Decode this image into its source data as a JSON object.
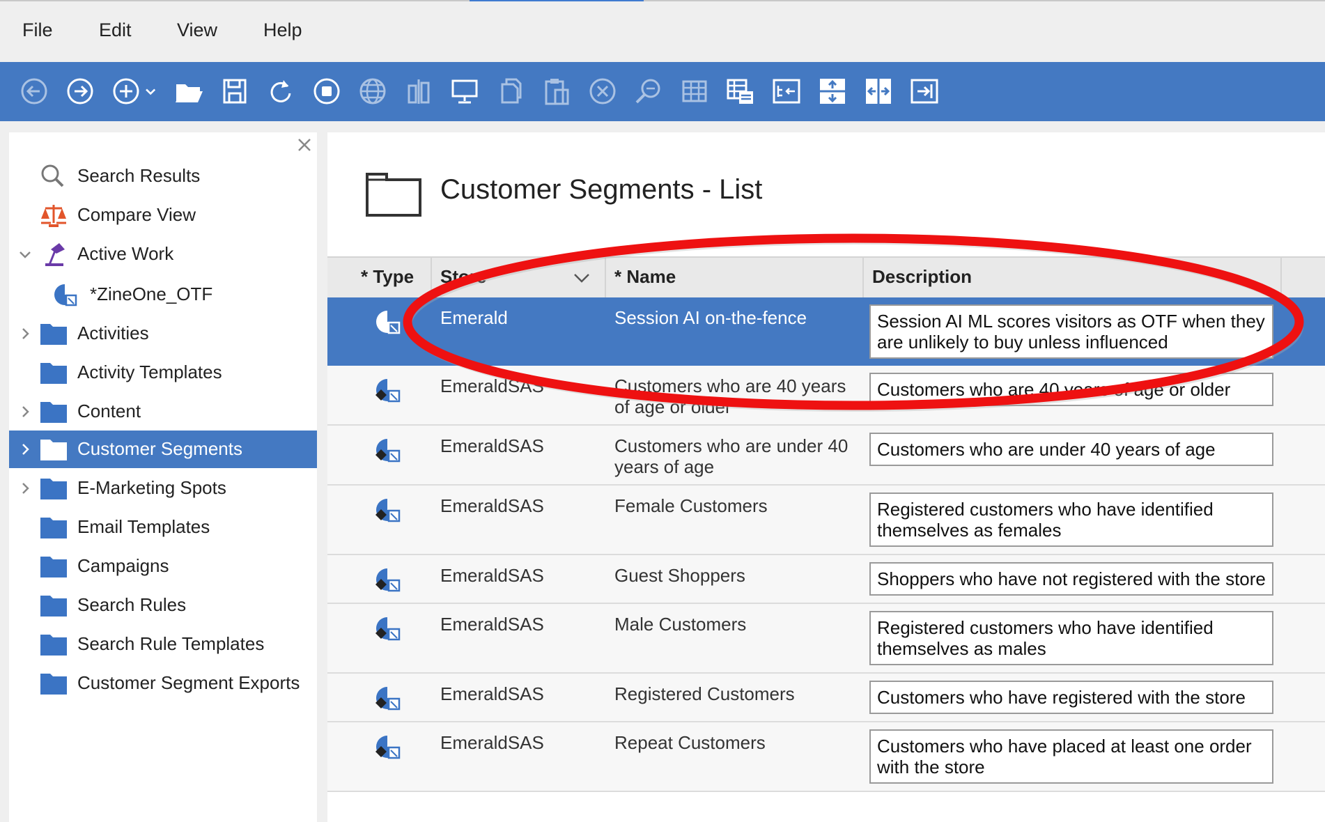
{
  "menu": {
    "items": [
      "File",
      "Edit",
      "View",
      "Help"
    ]
  },
  "toolbar": {
    "buttons": [
      "back-icon",
      "forward-icon",
      "new-icon",
      "open-icon",
      "save-icon",
      "refresh-icon",
      "stop-icon",
      "globe-icon",
      "columns-icon",
      "monitor-icon",
      "copy-icon",
      "paste-icon",
      "delete-icon",
      "find-icon",
      "table-icon",
      "list-view-icon",
      "properties-icon",
      "expand-vertical-icon",
      "expand-horizontal-icon",
      "maximize-icon"
    ]
  },
  "sidebar": {
    "items": [
      {
        "label": "Search Results",
        "icon": "magnifier-icon"
      },
      {
        "label": "Compare View",
        "icon": "scales-icon"
      },
      {
        "label": "Active Work",
        "icon": "work-lamp-icon"
      },
      {
        "label": "*ZineOne_OTF",
        "icon": "segment-icon"
      },
      {
        "label": "Activities",
        "icon": "folder-icon"
      },
      {
        "label": "Activity Templates",
        "icon": "folder-icon"
      },
      {
        "label": "Content",
        "icon": "folder-icon"
      },
      {
        "label": "Customer Segments",
        "icon": "folder-icon"
      },
      {
        "label": "E-Marketing Spots",
        "icon": "folder-icon"
      },
      {
        "label": "Email Templates",
        "icon": "folder-icon"
      },
      {
        "label": "Campaigns",
        "icon": "folder-icon"
      },
      {
        "label": "Search Rules",
        "icon": "folder-icon"
      },
      {
        "label": "Search Rule Templates",
        "icon": "folder-icon"
      },
      {
        "label": "Customer Segment Exports",
        "icon": "folder-icon"
      }
    ]
  },
  "main": {
    "title": "Customer Segments - List",
    "columns": {
      "type": "* Type",
      "store": "Store",
      "name": "* Name",
      "description": "Description"
    },
    "rows": [
      {
        "store": "Emerald",
        "name": "Session AI on-the-fence",
        "description": "Session AI ML scores visitors as OTF when they are unlikely to buy unless influenced"
      },
      {
        "store": "EmeraldSAS",
        "name": "Customers who are 40 years of age or older",
        "description": "Customers who are 40 years of age or older"
      },
      {
        "store": "EmeraldSAS",
        "name": "Customers who are under 40 years of age",
        "description": "Customers who are under 40 years of age"
      },
      {
        "store": "EmeraldSAS",
        "name": "Female Customers",
        "description": "Registered customers who have identified themselves as females"
      },
      {
        "store": "EmeraldSAS",
        "name": "Guest Shoppers",
        "description": "Shoppers who have not registered with the store"
      },
      {
        "store": "EmeraldSAS",
        "name": "Male Customers",
        "description": "Registered customers who have identified themselves as males"
      },
      {
        "store": "EmeraldSAS",
        "name": "Registered Customers",
        "description": "Customers who have registered with the store"
      },
      {
        "store": "EmeraldSAS",
        "name": "Repeat Customers",
        "description": "Customers who have placed at least one order with the store"
      }
    ]
  },
  "colors": {
    "accent": "#4479c2",
    "annotation": "#ee1111"
  }
}
